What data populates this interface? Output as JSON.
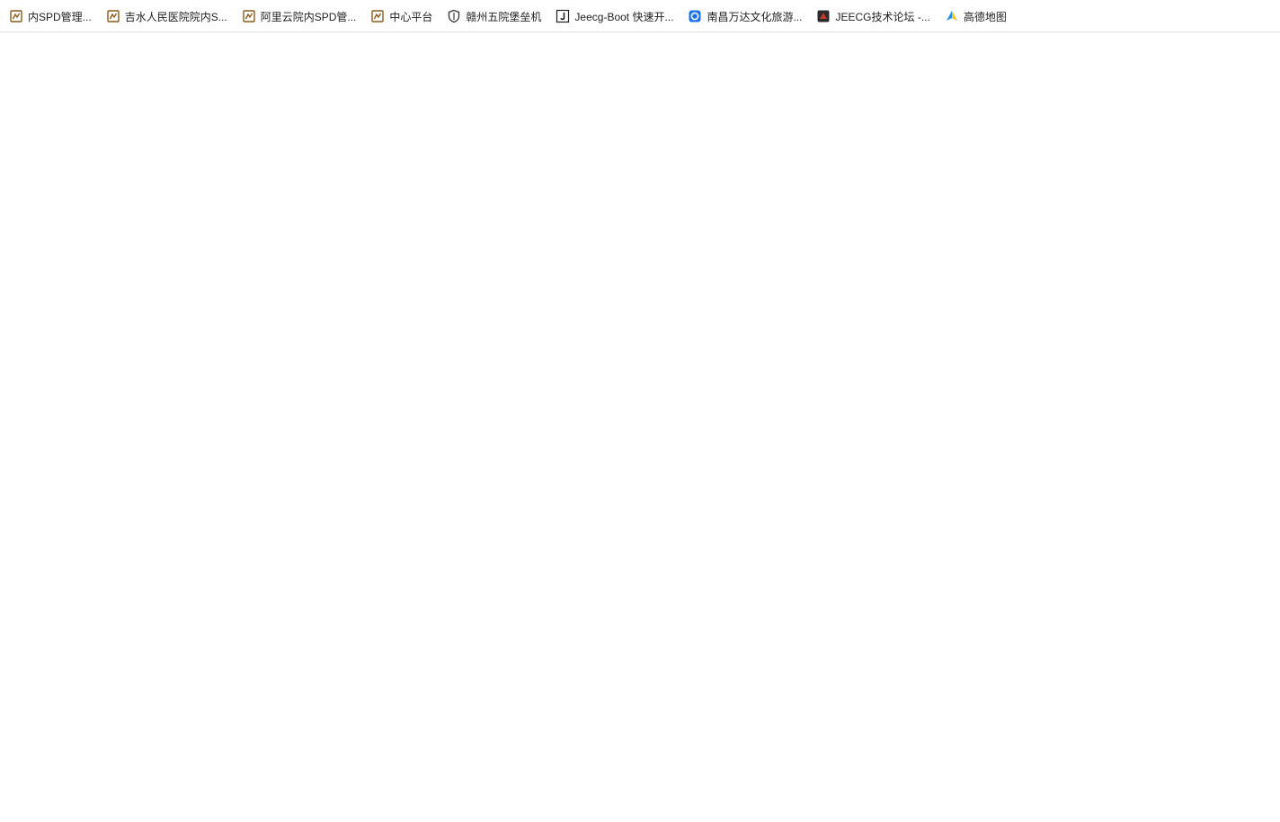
{
  "bookmarks_bar": {
    "items": [
      {
        "label": "内SPD管理...",
        "icon": "folder-doc-icon"
      },
      {
        "label": "吉水人民医院院内S...",
        "icon": "folder-doc-icon"
      },
      {
        "label": "阿里云院内SPD管...",
        "icon": "folder-doc-icon"
      },
      {
        "label": "中心平台",
        "icon": "folder-doc-icon"
      },
      {
        "label": "赣州五院堡垒机",
        "icon": "shield-icon"
      },
      {
        "label": "Jeecg-Boot 快速开...",
        "icon": "j-logo-icon"
      },
      {
        "label": "南昌万达文化旅游...",
        "icon": "blue-circle-logo-icon"
      },
      {
        "label": "JEECG技术论坛 -...",
        "icon": "jeecg-forum-icon"
      },
      {
        "label": "高德地图",
        "icon": "amap-icon"
      }
    ],
    "colors": {
      "folder": "#8a5a1a",
      "shield": "#3c3c3c",
      "blue_logo": "#1a73e8",
      "forum": "#c0392b",
      "amap": "#2a8cf0"
    }
  }
}
